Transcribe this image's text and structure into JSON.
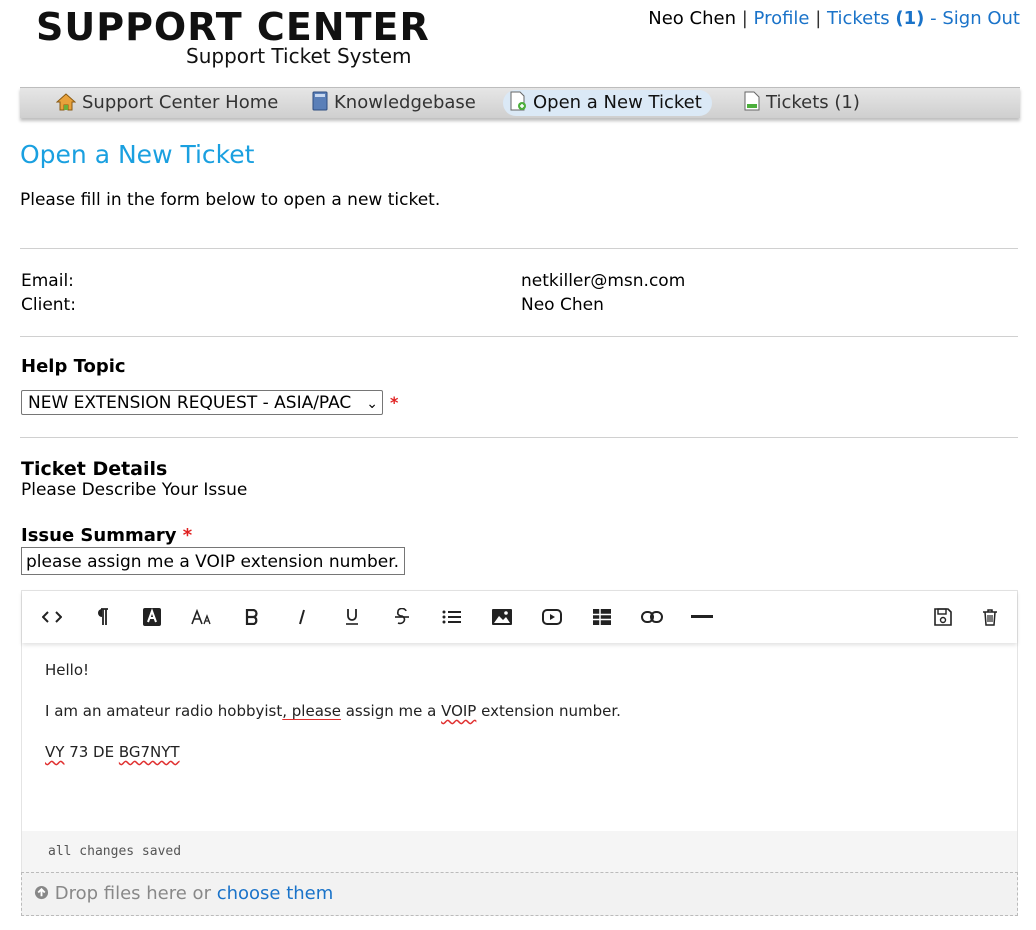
{
  "header": {
    "logo_title": "SUPPORT CENTER",
    "logo_subtitle": "Support Ticket System",
    "user_name": "Neo Chen",
    "sep1": "|",
    "profile_link": "Profile",
    "sep2": "|",
    "tickets_link": "Tickets",
    "tickets_count": "(1)",
    "sep3": "-",
    "signout_link": "Sign Out"
  },
  "nav": {
    "items": [
      {
        "label": "Support Center Home",
        "icon": "home-icon"
      },
      {
        "label": "Knowledgebase",
        "icon": "book-icon"
      },
      {
        "label": "Open a New Ticket",
        "icon": "new-ticket-icon",
        "active": true
      },
      {
        "label": "Tickets (1)",
        "icon": "ticket-doc-icon"
      }
    ]
  },
  "page": {
    "title": "Open a New Ticket",
    "intro": "Please fill in the form below to open a new ticket."
  },
  "contact": {
    "email_label": "Email:",
    "email_value": "netkiller@msn.com",
    "client_label": "Client:",
    "client_value": "Neo Chen"
  },
  "help_topic": {
    "heading": "Help Topic",
    "selected": "NEW EXTENSION REQUEST - ASIA/PAC",
    "required_mark": "*"
  },
  "details": {
    "heading": "Ticket Details",
    "subheading": "Please Describe Your Issue",
    "summary_label": "Issue Summary",
    "summary_required": "*",
    "summary_value": "please assign me a VOIP extension number."
  },
  "editor": {
    "toolbar": [
      "code-view-icon",
      "paragraph-icon",
      "text-color-icon",
      "font-size-icon",
      "bold-icon",
      "italic-icon",
      "underline-icon",
      "strikethrough-icon",
      "list-icon",
      "image-icon",
      "video-icon",
      "table-icon",
      "link-icon",
      "horizontal-rule-icon",
      "save-icon",
      "trash-icon"
    ],
    "line1": "Hello!",
    "line2_a": "I am an amateur radio hobbyist",
    "line2_b": ", please",
    "line2_c": " assign me a ",
    "line2_d": "VOIP",
    "line2_e": " extension number.",
    "line3_a": "VY",
    "line3_b": " 73 DE ",
    "line3_c": "BG7NYT",
    "status": "all changes saved"
  },
  "dropzone": {
    "text": "Drop files here or",
    "link": "choose them"
  }
}
